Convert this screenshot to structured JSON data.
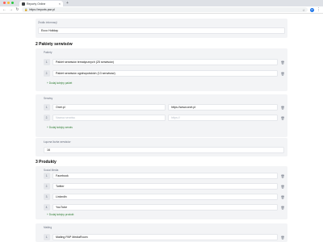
{
  "browser": {
    "tab_title": "Reporty Online",
    "tab_close": "×",
    "new_tab": "+",
    "url": "https://reports.pwr.pl",
    "profile_initial": "R",
    "colors": {
      "red": "#ff5f57",
      "yellow": "#febc2e",
      "green": "#28c840"
    }
  },
  "top": {
    "label": "Źródło informacji",
    "value": "Ecco Holiday"
  },
  "section2": {
    "title": "2 Pakiety serwisów",
    "packages": {
      "label": "Pakiety",
      "items": [
        {
          "num": "1.",
          "value": "Pakiet serwisów tematycznych (25 serwisów)"
        },
        {
          "num": "2.",
          "value": "Pakiet serwisów ogólnopolskich (13 serwisów)"
        }
      ],
      "add": "+ Dodaj kolejny pakiet"
    },
    "services": {
      "label": "Serwisy",
      "items": [
        {
          "num": "1.",
          "name": "Onet.pl",
          "url": "https://www.onet.pl"
        }
      ],
      "new_name_placeholder": "Nazwa serwisu",
      "new_url_placeholder": "https://",
      "new_num": "2.",
      "add": "+ Dodaj kolejny serwis"
    },
    "count": {
      "label": "Łączna liczba serwisów",
      "value": "16"
    }
  },
  "section3": {
    "title": "3 Produkty",
    "social": {
      "label": "Social Media",
      "items": [
        {
          "num": "1.",
          "value": "Facebook"
        },
        {
          "num": "2.",
          "value": "Twitter"
        },
        {
          "num": "3.",
          "value": "LinkedIn"
        },
        {
          "num": "4.",
          "value": "YouTube"
        }
      ],
      "add": "+ Dodaj kolejny produkt"
    },
    "mailing": {
      "label": "Mailing",
      "items": [
        {
          "num": "1.",
          "value": "Mailing PAP MediaRoom"
        }
      ]
    }
  }
}
